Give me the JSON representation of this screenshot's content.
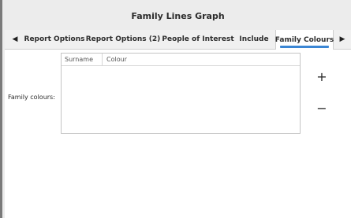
{
  "window": {
    "title": "Family Lines Graph"
  },
  "tabs": [
    {
      "label": "Report Options"
    },
    {
      "label": "Report Options (2)"
    },
    {
      "label": "People of Interest"
    },
    {
      "label": "Include"
    },
    {
      "label": "Family Colours",
      "active": true
    }
  ],
  "tab_scroll": {
    "left_icon": "left-arrow-icon",
    "right_icon": "right-arrow-icon"
  },
  "family_colours": {
    "label": "Family colours:",
    "columns": [
      "Surname",
      "Colour"
    ],
    "rows": [],
    "add_icon": "plus-icon",
    "remove_icon": "minus-icon"
  },
  "colors": {
    "accent": "#3b86d4",
    "titlebar": "#ececec",
    "tabbar": "#f0f0f0"
  }
}
